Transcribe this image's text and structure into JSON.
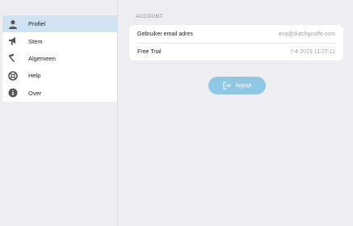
{
  "sidebar": {
    "items": [
      {
        "label": "Profiel",
        "icon": "user-icon",
        "active": true
      },
      {
        "label": "Stem",
        "icon": "megaphone-icon",
        "active": false
      },
      {
        "label": "Algemeen",
        "icon": "hammer-icon",
        "active": false
      },
      {
        "label": "Help",
        "icon": "lifebuoy-icon",
        "active": false
      },
      {
        "label": "Over",
        "icon": "info-icon",
        "active": false
      }
    ]
  },
  "account": {
    "section_title": "ACCOUNT",
    "rows": [
      {
        "label": "Gebruiker email adres",
        "value": "eva@dutchgiraffe.com"
      },
      {
        "label": "Free Trial",
        "value": "7-4-2019 11:27:11"
      }
    ]
  },
  "logout": {
    "label": "logout",
    "icon": "logout-icon"
  },
  "colors": {
    "background": "#eeeef2",
    "active_item": "#cfe3f2",
    "logout_button": "#8ec8e4"
  }
}
